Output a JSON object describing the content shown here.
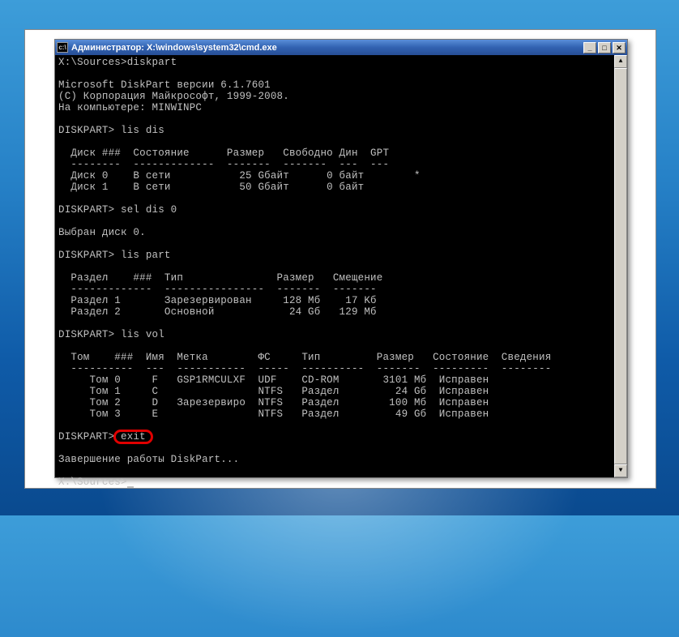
{
  "window": {
    "title": "Администратор: X:\\windows\\system32\\cmd.exe"
  },
  "console": {
    "line01": "X:\\Sources>diskpart",
    "line02": "",
    "line03": "Microsoft DiskPart версии 6.1.7601",
    "line04": "(C) Корпорация Майкрософт, 1999-2008.",
    "line05": "На компьютере: MINWINPC",
    "line06": "",
    "line07": "DISKPART> lis dis",
    "line08": "",
    "line09": "  Диск ###  Состояние      Размер   Свободно Дин  GPT",
    "line10": "  --------  -------------  -------  -------  ---  ---",
    "line11": "  Диск 0    В сети           25 Gбайт      0 байт        *",
    "line12": "  Диск 1    В сети           50 Gбайт      0 байт",
    "line13": "",
    "line14": "DISKPART> sel dis 0",
    "line15": "",
    "line16": "Выбран диск 0.",
    "line17": "",
    "line18": "DISKPART> lis part",
    "line19": "",
    "line20": "  Раздел    ###  Тип               Размер   Смещение",
    "line21": "  -------------  ----------------  -------  -------",
    "line22": "  Раздел 1       Зарезервирован     128 Mб    17 Kб",
    "line23": "  Раздел 2       Основной            24 Gб   129 Mб",
    "line24": "",
    "line25": "DISKPART> lis vol",
    "line26": "",
    "line27": "  Том    ###  Имя  Метка        ФС     Тип         Размер   Состояние  Сведения",
    "line28": "  ----------  ---  -----------  -----  ----------  -------  ---------  --------",
    "line29": "     Том 0     F   GSP1RMCULXF  UDF    CD-ROM       3101 Mб  Исправен",
    "line30": "     Том 1     C                NTFS   Раздел         24 Gб  Исправен",
    "line31": "     Том 2     D   Зарезервиро  NTFS   Раздел        100 Mб  Исправен",
    "line32": "     Том 3     E                NTFS   Раздел         49 Gб  Исправен",
    "line33": "",
    "line34": "DISKPART> exit",
    "line35": "",
    "line36": "Завершение работы DiskPart...",
    "line37": "",
    "line38": "X:\\Sources>"
  },
  "controls": {
    "min": "_",
    "max": "□",
    "close": "✕",
    "up": "▲",
    "down": "▼"
  }
}
